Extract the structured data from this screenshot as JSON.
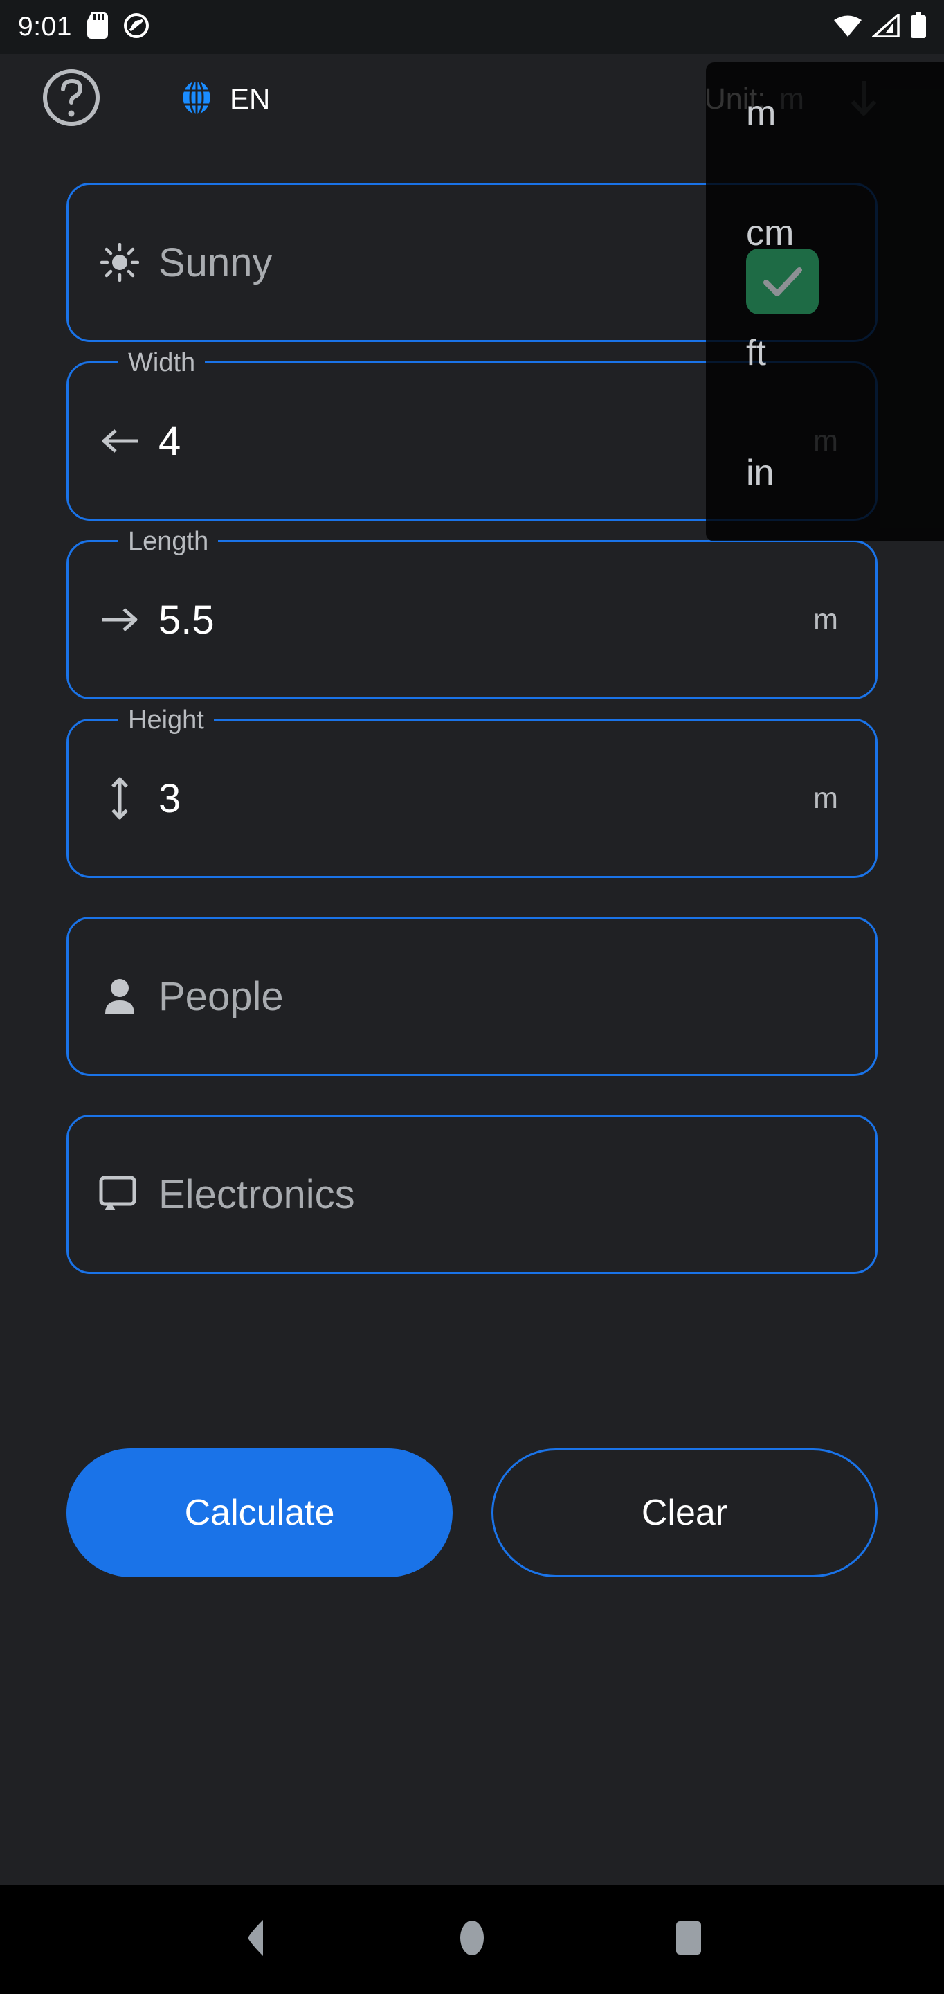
{
  "status_bar": {
    "clock": "9:01",
    "left_icons": [
      "sd-card-icon",
      "do-not-disturb-icon"
    ],
    "right_icons": [
      "wifi-icon",
      "cellular-signal-icon",
      "battery-icon"
    ]
  },
  "header": {
    "help_icon": "help-circle-icon",
    "language_icon": "globe-icon",
    "language_code": "EN",
    "unit_label": "Unit:",
    "unit_value": "m",
    "unit_arrow_icon": "arrow-down-icon",
    "accent_color": "#1a73e8",
    "globe_color": "#1a8cff"
  },
  "unit_dropdown": {
    "open": true,
    "selected": "cm",
    "check_icon": "check-icon",
    "check_badge_color": "#1e6b45",
    "options": [
      {
        "label": "m",
        "selected": false
      },
      {
        "label": "cm",
        "selected": true
      },
      {
        "label": "ft",
        "selected": false
      },
      {
        "label": "in",
        "selected": false
      }
    ]
  },
  "form": {
    "fields": [
      {
        "name": "weather",
        "legend": "",
        "icon": "sun-icon",
        "value": "Sunny",
        "is_placeholder": true,
        "suffix": ""
      },
      {
        "name": "width",
        "legend": "Width",
        "icon": "arrow-left-icon",
        "value": "4",
        "is_placeholder": false,
        "suffix": "m"
      },
      {
        "name": "length",
        "legend": "Length",
        "icon": "arrow-right-icon",
        "value": "5.5",
        "is_placeholder": false,
        "suffix": "m"
      },
      {
        "name": "height",
        "legend": "Height",
        "icon": "arrows-vertical-icon",
        "value": "3",
        "is_placeholder": false,
        "suffix": "m"
      },
      {
        "name": "people",
        "legend": "",
        "icon": "person-icon",
        "value": "People",
        "is_placeholder": true,
        "suffix": ""
      },
      {
        "name": "electronics",
        "legend": "",
        "icon": "cast-device-icon",
        "value": "Electronics",
        "is_placeholder": true,
        "suffix": ""
      }
    ]
  },
  "actions": {
    "calculate_label": "Calculate",
    "clear_label": "Clear"
  },
  "nav_bar": {
    "back_icon": "back-triangle-icon",
    "home_icon": "home-circle-icon",
    "recents_icon": "recents-square-icon"
  }
}
